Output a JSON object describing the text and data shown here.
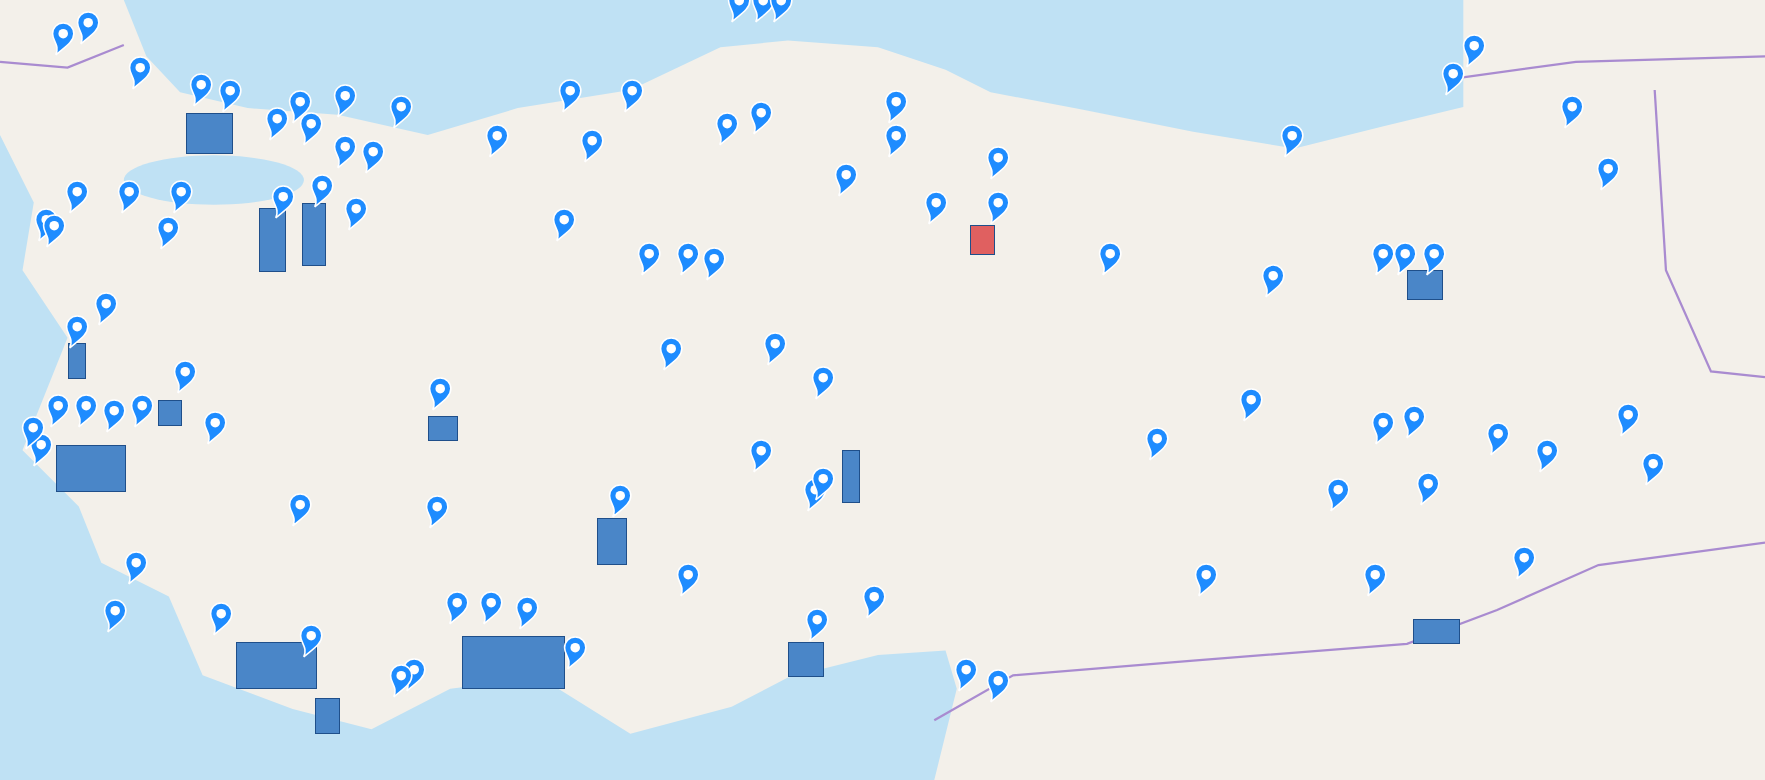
{
  "map": {
    "areas": [
      {
        "color": "#4a86c8"
      },
      {
        "color": "#4a86c8"
      },
      {
        "color": "#4a86c8"
      },
      {
        "color": "#4a86c8"
      },
      {
        "color": "#4a86c8"
      },
      {
        "color": "#4a86c8"
      },
      {
        "color": "#4a86c8"
      },
      {
        "color": "#4a86c8"
      },
      {
        "color": "#4a86c8"
      },
      {
        "color": "#4a86c8"
      },
      {
        "color": "#4a86c8"
      },
      {
        "color": "#4a86c8"
      },
      {
        "color": "#4a86c8"
      },
      {
        "color": "#4a86c8"
      },
      {
        "color": "#4a86c8"
      },
      {
        "color": "#e06060"
      }
    ],
    "pins": [
      {
        "kind": "pin"
      },
      {
        "kind": "pin"
      },
      {
        "kind": "pin"
      },
      {
        "kind": "pin"
      },
      {
        "kind": "pin"
      },
      {
        "kind": "pin"
      },
      {
        "kind": "pin"
      },
      {
        "kind": "pin"
      },
      {
        "kind": "pin"
      },
      {
        "kind": "pin"
      },
      {
        "kind": "pin"
      },
      {
        "kind": "pin"
      },
      {
        "kind": "pin"
      },
      {
        "kind": "pin"
      },
      {
        "kind": "pin"
      },
      {
        "kind": "pin"
      },
      {
        "kind": "pin"
      },
      {
        "kind": "pin"
      },
      {
        "kind": "pin"
      },
      {
        "kind": "pin"
      },
      {
        "kind": "pin"
      },
      {
        "kind": "pin"
      },
      {
        "kind": "pin"
      },
      {
        "kind": "pin"
      },
      {
        "kind": "pin"
      },
      {
        "kind": "pin"
      },
      {
        "kind": "pin"
      },
      {
        "kind": "pin"
      },
      {
        "kind": "pin"
      },
      {
        "kind": "pin"
      },
      {
        "kind": "pin"
      },
      {
        "kind": "pin"
      },
      {
        "kind": "pin"
      },
      {
        "kind": "pin"
      },
      {
        "kind": "pin"
      },
      {
        "kind": "pin"
      },
      {
        "kind": "pin"
      },
      {
        "kind": "pin"
      },
      {
        "kind": "pin"
      },
      {
        "kind": "pin"
      },
      {
        "kind": "pin"
      },
      {
        "kind": "pin"
      },
      {
        "kind": "pin"
      },
      {
        "kind": "pin"
      },
      {
        "kind": "pin"
      },
      {
        "kind": "pin"
      },
      {
        "kind": "pin"
      },
      {
        "kind": "pin"
      },
      {
        "kind": "pin"
      },
      {
        "kind": "pin"
      },
      {
        "kind": "pin"
      },
      {
        "kind": "pin"
      },
      {
        "kind": "pin"
      },
      {
        "kind": "pin"
      },
      {
        "kind": "pin"
      },
      {
        "kind": "pin"
      },
      {
        "kind": "pin"
      },
      {
        "kind": "pin"
      },
      {
        "kind": "pin"
      },
      {
        "kind": "pin"
      },
      {
        "kind": "pin"
      },
      {
        "kind": "pin"
      },
      {
        "kind": "pin"
      },
      {
        "kind": "pin"
      },
      {
        "kind": "pin"
      },
      {
        "kind": "pin"
      },
      {
        "kind": "pin"
      },
      {
        "kind": "pin"
      },
      {
        "kind": "pin"
      },
      {
        "kind": "pin"
      },
      {
        "kind": "pin"
      },
      {
        "kind": "pin"
      },
      {
        "kind": "pin"
      },
      {
        "kind": "pin"
      },
      {
        "kind": "pin"
      },
      {
        "kind": "pin"
      },
      {
        "kind": "pin"
      },
      {
        "kind": "pin"
      },
      {
        "kind": "pin"
      },
      {
        "kind": "pin"
      },
      {
        "kind": "pin"
      },
      {
        "kind": "pin"
      },
      {
        "kind": "pin"
      },
      {
        "kind": "pin"
      },
      {
        "kind": "pin"
      },
      {
        "kind": "pin"
      },
      {
        "kind": "pin"
      },
      {
        "kind": "pin"
      },
      {
        "kind": "pin"
      },
      {
        "kind": "pin"
      },
      {
        "kind": "pin"
      },
      {
        "kind": "pin"
      },
      {
        "kind": "pin"
      },
      {
        "kind": "pin"
      },
      {
        "kind": "pin"
      },
      {
        "kind": "pin"
      },
      {
        "kind": "pin"
      },
      {
        "kind": "pin"
      }
    ]
  }
}
